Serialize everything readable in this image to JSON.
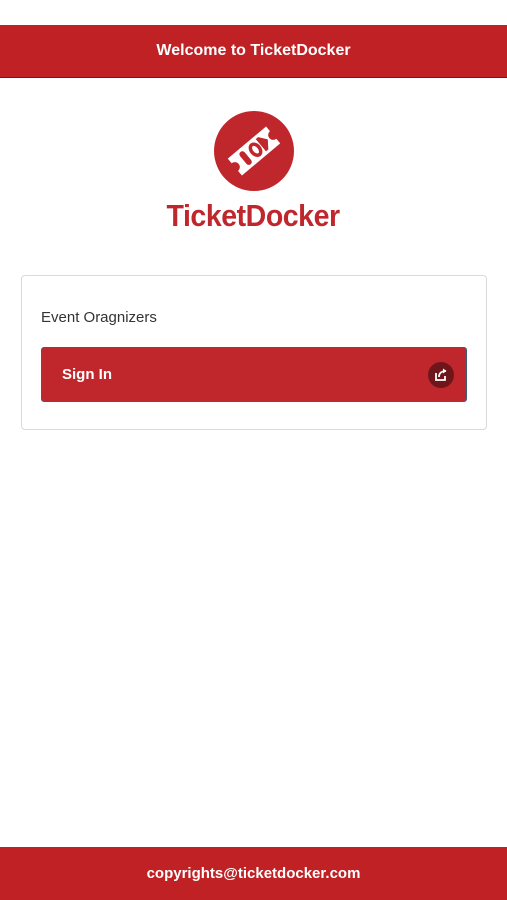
{
  "header": {
    "title": "Welcome to TicketDocker"
  },
  "logo": {
    "brand_name": "TicketDocker",
    "icon": "ticket-icon"
  },
  "card": {
    "title": "Event Oragnizers",
    "signin_button": {
      "label": "Sign In",
      "icon": "share-icon"
    }
  },
  "footer": {
    "text": "copyrights@ticketdocker.com"
  },
  "colors": {
    "brand": "#bf2125",
    "icon_circle": "#6e1619"
  }
}
